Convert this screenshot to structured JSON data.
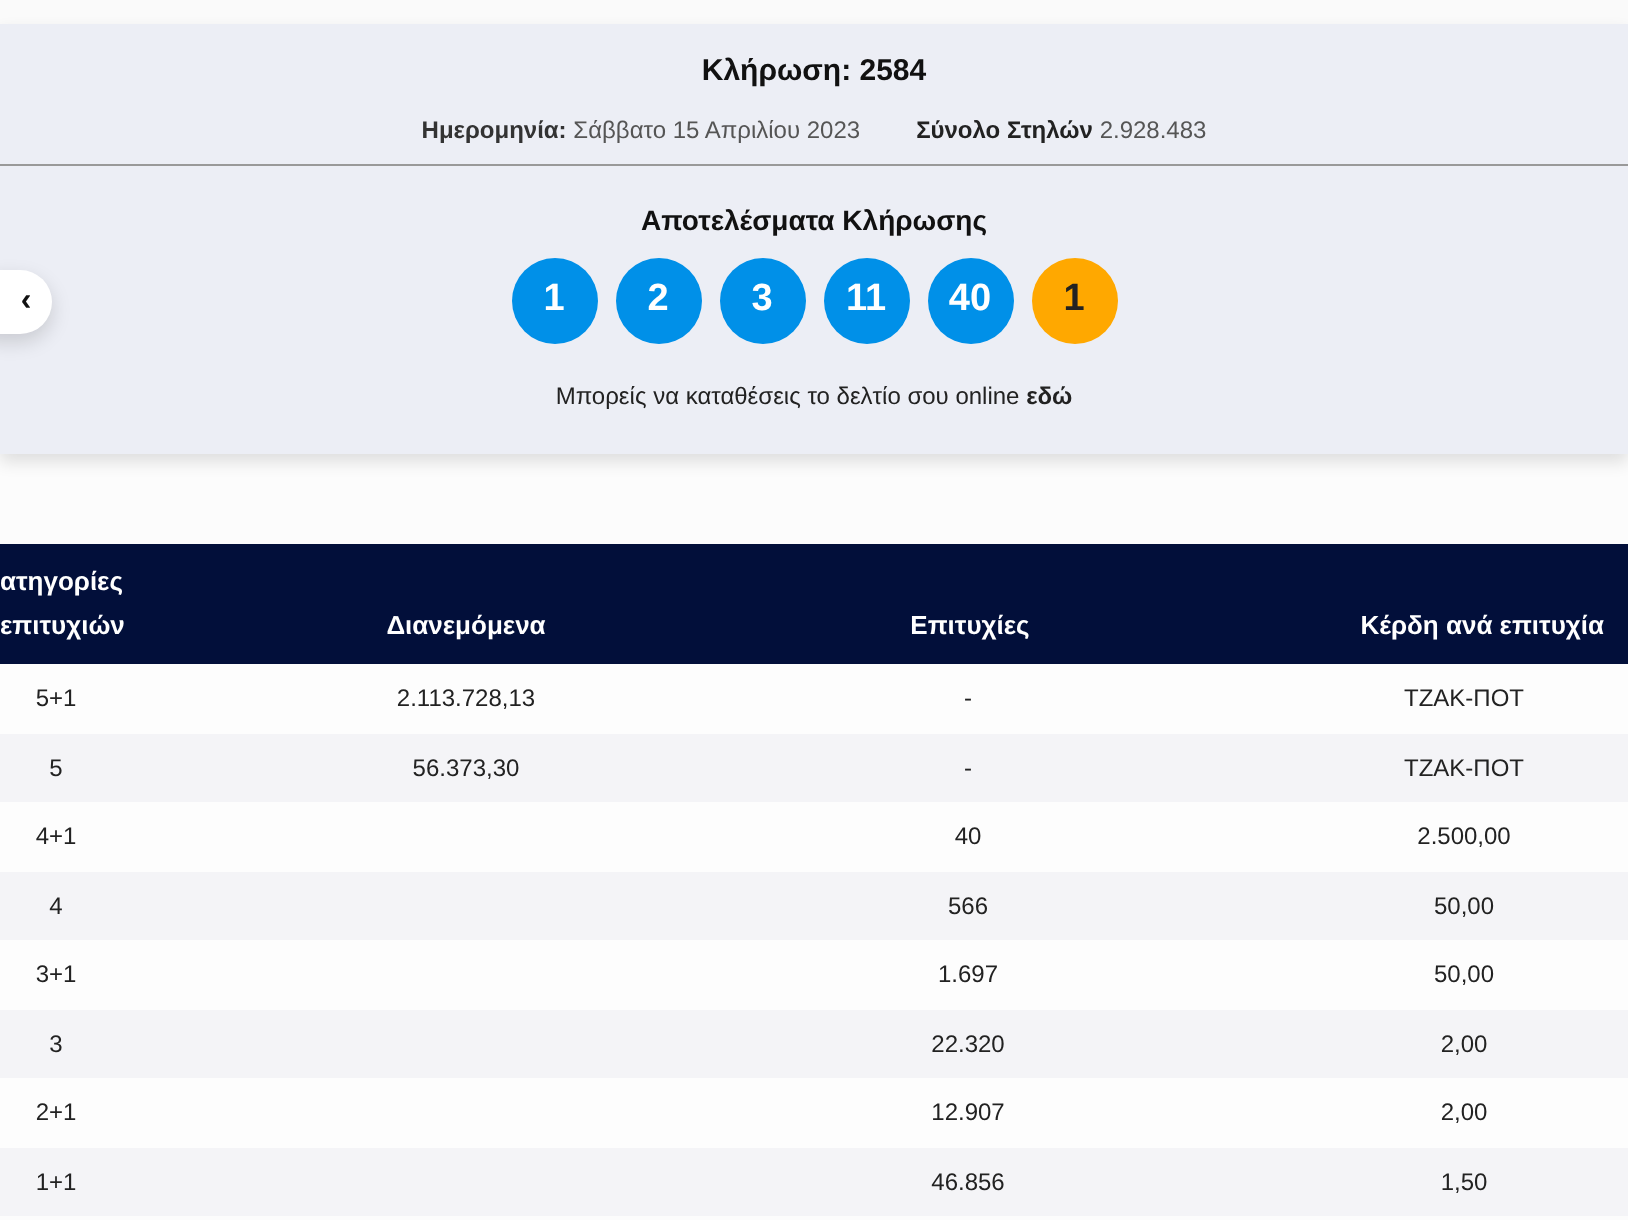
{
  "draw": {
    "title": "Κλήρωση: 2584",
    "date_label": "Ημερομηνία:",
    "date_value": "Σάββατο 15 Απριλίου 2023",
    "columns_label": "Σύνολο Στηλών",
    "columns_value": "2.928.483"
  },
  "results": {
    "title": "Αποτελέσματα Κλήρωσης",
    "balls": [
      {
        "number": "1",
        "kind": "main"
      },
      {
        "number": "2",
        "kind": "main"
      },
      {
        "number": "3",
        "kind": "main"
      },
      {
        "number": "11",
        "kind": "main"
      },
      {
        "number": "40",
        "kind": "main"
      },
      {
        "number": "1",
        "kind": "bonus"
      }
    ],
    "note": "Μπορείς να καταθέσεις το δελτίο σου online **εδώ**",
    "prev_button": "‹"
  },
  "table": {
    "columns": [
      "ατηγορίες επιτυχιών",
      "Διανεμόμενα",
      "Επιτυχίες",
      "Κέρδη ανά επιτυχία"
    ],
    "rows": [
      [
        "5+1",
        "2.113.728,13",
        "-",
        "ΤΖΑΚ-ΠΟΤ"
      ],
      [
        "5",
        "56.373,30",
        "-",
        "ΤΖΑΚ-ΠΟΤ"
      ],
      [
        "4+1",
        "",
        "40",
        "2.500,00"
      ],
      [
        "4",
        "",
        "566",
        "50,00"
      ],
      [
        "3+1",
        "",
        "1.697",
        "50,00"
      ],
      [
        "3",
        "",
        "22.320",
        "2,00"
      ],
      [
        "2+1",
        "",
        "12.907",
        "2,00"
      ],
      [
        "1+1",
        "",
        "46.856",
        "1,50"
      ]
    ]
  }
}
